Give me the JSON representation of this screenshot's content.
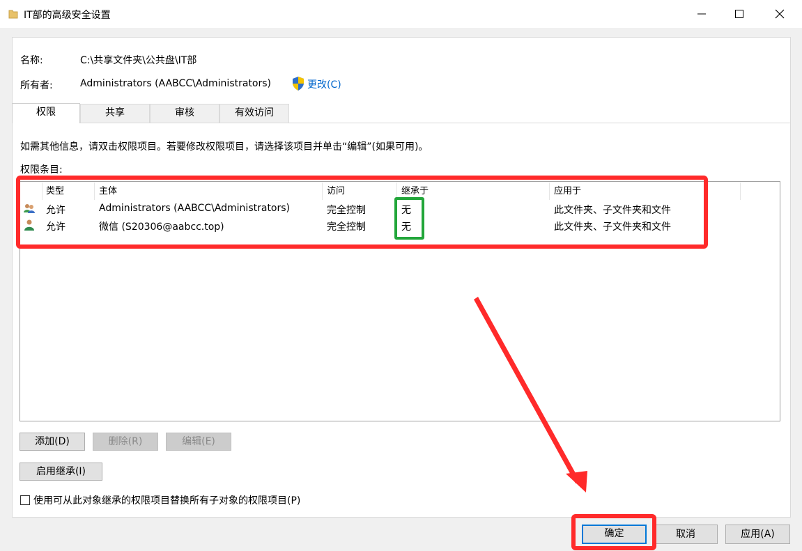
{
  "window": {
    "title": "IT部的高级安全设置",
    "icon": "folder-icon",
    "minimize_icon": "minimize-icon",
    "maximize_icon": "maximize-icon",
    "close_icon": "close-icon"
  },
  "header": {
    "name_label": "名称:",
    "name_value": "C:\\共享文件夹\\公共盘\\IT部",
    "owner_label": "所有者:",
    "owner_value": "Administrators (AABCC\\Administrators)",
    "change_link": "更改(C)",
    "shield_icon": "uac-shield-icon"
  },
  "tabs": [
    {
      "label": "权限",
      "active": true
    },
    {
      "label": "共享",
      "active": false
    },
    {
      "label": "审核",
      "active": false
    },
    {
      "label": "有效访问",
      "active": false
    }
  ],
  "permissions": {
    "instructions": "如需其他信息，请双击权限项目。若要修改权限项目，请选择该项目并单击“编辑”(如果可用)。",
    "entries_label": "权限条目:",
    "columns": [
      "类型",
      "主体",
      "访问",
      "继承于",
      "应用于"
    ],
    "rows": [
      {
        "icon": "group-icon",
        "type": "允许",
        "principal": "Administrators (AABCC\\Administrators)",
        "access": "完全控制",
        "inherited_from": "无",
        "applies_to": "此文件夹、子文件夹和文件"
      },
      {
        "icon": "user-icon",
        "type": "允许",
        "principal": "微信 (S20306@aabcc.top)",
        "access": "完全控制",
        "inherited_from": "无",
        "applies_to": "此文件夹、子文件夹和文件"
      }
    ]
  },
  "buttons": {
    "add": "添加(D)",
    "remove": "删除(R)",
    "edit": "编辑(E)",
    "enable_inheritance": "启用继承(I)",
    "replace_checkbox": "使用可从此对象继承的权限项目替换所有子对象的权限项目(P)",
    "ok": "确定",
    "cancel": "取消",
    "apply": "应用(A)"
  },
  "colors": {
    "annotation_red": "#ff2a2a",
    "annotation_green": "#22a63a",
    "link": "#0066cc",
    "default_button_border": "#0078d7"
  }
}
